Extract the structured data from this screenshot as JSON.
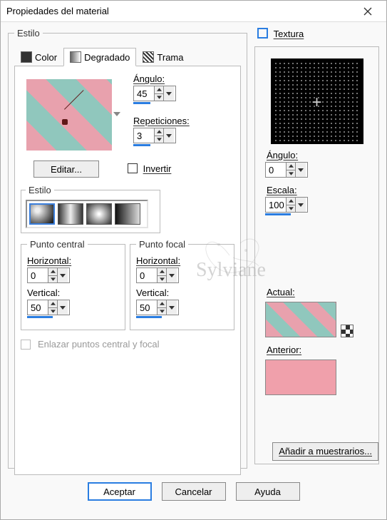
{
  "window": {
    "title": "Propiedades del material"
  },
  "style_group": {
    "legend": "Estilo",
    "tabs": {
      "color": "Color",
      "gradient": "Degradado",
      "pattern": "Trama"
    }
  },
  "gradient": {
    "angle_label": "Ángulo:",
    "angle_value": "45",
    "reps_label": "Repeticiones:",
    "reps_value": "3",
    "edit": "Editar...",
    "invert": "Invertir",
    "style_legend": "Estilo"
  },
  "point_center": {
    "legend": "Punto central",
    "h_label": "Horizontal:",
    "h_value": "0",
    "v_label": "Vertical:",
    "v_value": "50"
  },
  "point_focal": {
    "legend": "Punto focal",
    "h_label": "Horizontal:",
    "h_value": "0",
    "v_label": "Vertical:",
    "v_value": "50"
  },
  "link_points": "Enlazar puntos central y focal",
  "texture": {
    "label": "Textura",
    "angle_label": "Ángulo:",
    "angle_value": "0",
    "scale_label": "Escala:",
    "scale_value": "100",
    "actual_label": "Actual:",
    "prev_label": "Anterior:",
    "add_swatch": "Añadir a muestrarios..."
  },
  "buttons": {
    "ok": "Aceptar",
    "cancel": "Cancelar",
    "help": "Ayuda"
  },
  "watermark": "Sylviane"
}
